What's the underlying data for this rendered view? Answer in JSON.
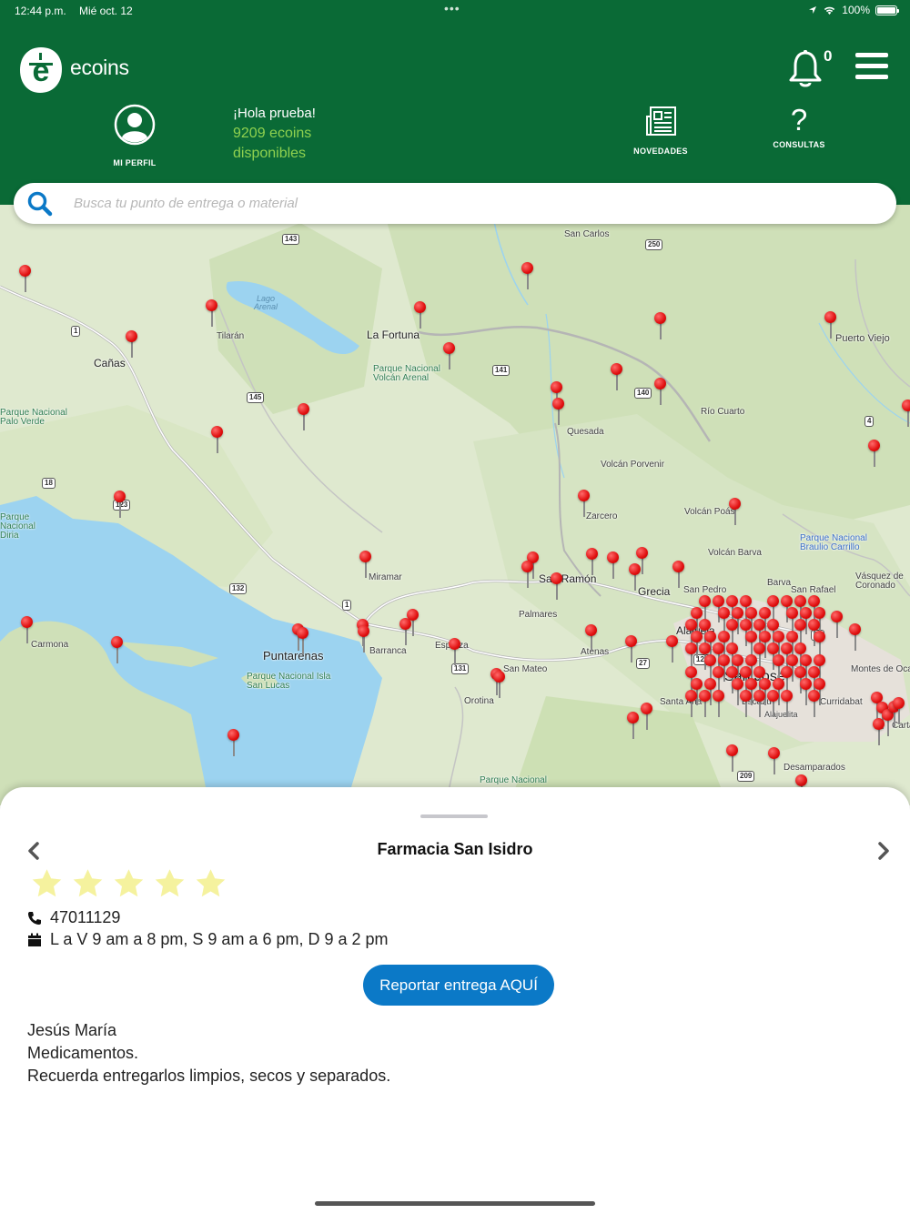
{
  "status_bar": {
    "time": "12:44 p.m.",
    "date": "Mié oct. 12",
    "battery": "100%"
  },
  "header": {
    "brand": "ecoins",
    "notification_count": "0",
    "profile_label": "MI PERFIL",
    "greeting": "¡Hola prueba!",
    "balance_line1": "9209 ecoins",
    "balance_line2": "disponibles",
    "news_label": "NOVEDADES",
    "help_label": "CONSULTAS",
    "help_glyph": "?"
  },
  "search": {
    "placeholder": "Busca tu punto de entrega o material"
  },
  "map": {
    "places": [
      "San Carlos",
      "Lago Arenal",
      "La Fortuna",
      "Tilarán",
      "Cañas",
      "Parque Nacional Volcán Arenal",
      "Puerto Viejo",
      "Río Cuarto",
      "Quesada",
      "Volcán Porvenir",
      "Zarcero",
      "Volcán Poás",
      "Parque Nacional Braulio Carrillo",
      "Volcán Barva",
      "Miramar",
      "San Ramón",
      "Grecia",
      "San Pedro",
      "Barva",
      "San Rafael",
      "Vásquez de Coronado",
      "Palmares",
      "Alajuela",
      "Carmona",
      "Puntarenas",
      "Parque Nacional Isla San Lucas",
      "Barranca",
      "Esparza",
      "Atenas",
      "San Mateo",
      "Orotina",
      "San José",
      "Santa Ana",
      "Escazú",
      "Alajuelita",
      "Curridabat",
      "Montes de Oca",
      "Cartago",
      "Desamparados",
      "Parque Nacional",
      "Parque Nacional Palo Verde",
      "Parque Nacional Diria"
    ],
    "roads": [
      "143",
      "250",
      "1",
      "141",
      "140",
      "145",
      "4",
      "18",
      "123",
      "132",
      "1",
      "131",
      "27",
      "32",
      "209",
      "122"
    ]
  },
  "point": {
    "name": "Farmacia San Isidro",
    "rating": 5,
    "phone": "47011129",
    "hours": "L a V 9 am a 8 pm, S 9 am a 6 pm, D 9 a 2 pm",
    "report_button": "Reportar entrega AQUÍ",
    "location": "Jesús María",
    "materials": "Medicamentos.",
    "note": "Recuerda entregarlos limpios, secos y separados."
  },
  "colors": {
    "brand_green": "#0a6a36",
    "coins_green": "#8fd14f",
    "button_blue": "#0b79c7",
    "star_yellow": "#f5f29e",
    "pin_red": "#e01010"
  }
}
